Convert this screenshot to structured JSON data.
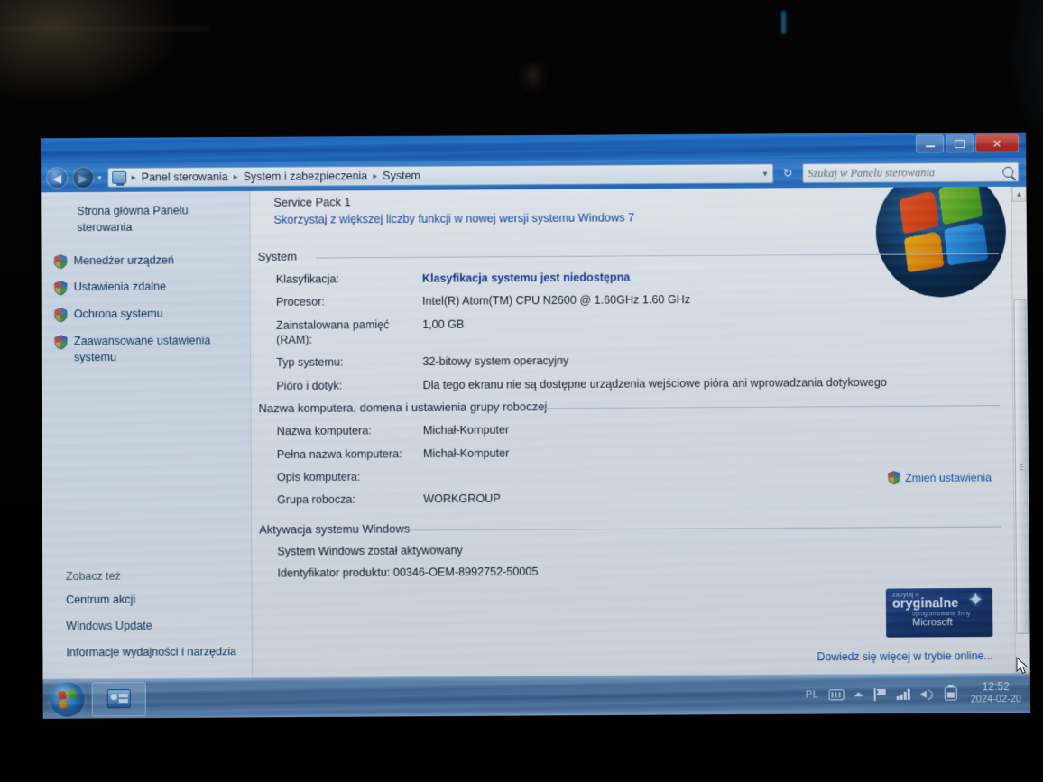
{
  "window": {
    "min_label": "Minimalizuj",
    "max_label": "Maksymalizuj",
    "close_label": "✕"
  },
  "nav": {
    "back_glyph": "◀",
    "forward_glyph": "▶",
    "dropdown_glyph": "▾",
    "refresh_glyph": "↻",
    "breadcrumb": [
      "Panel sterowania",
      "System i zabezpieczenia",
      "System"
    ],
    "separator": "▸",
    "caret": "▾"
  },
  "search": {
    "placeholder": "Szukaj w Panelu sterowania",
    "value": "",
    "icon": "search-icon"
  },
  "sidebar": {
    "home_label": "Strona główna Panelu sterowania",
    "items": [
      {
        "label": "Menedżer urządzeń",
        "icon": "shield-icon"
      },
      {
        "label": "Ustawienia zdalne",
        "icon": "shield-icon"
      },
      {
        "label": "Ochrona systemu",
        "icon": "shield-icon"
      },
      {
        "label": "Zaawansowane ustawienia systemu",
        "icon": "shield-icon"
      }
    ],
    "see_also_title": "Zobacz też",
    "see_also": [
      "Centrum akcji",
      "Windows Update",
      "Informacje wydajności i narzędzia"
    ]
  },
  "content": {
    "service_pack": "Service Pack 1",
    "upgrade_link": "Skorzystaj z większej liczby funkcji w nowej wersji systemu Windows 7",
    "system_section": {
      "heading": "System",
      "rows": [
        {
          "label": "Klasyfikacja:",
          "value": "Klasyfikacja systemu jest niedostępna",
          "style": "blue"
        },
        {
          "label": "Procesor:",
          "value": "Intel(R) Atom(TM) CPU N2600   @ 1.60GHz   1.60 GHz",
          "style": "plain"
        },
        {
          "label": "Zainstalowana pamięć (RAM):",
          "value": "1,00 GB",
          "style": "plain"
        },
        {
          "label": "Typ systemu:",
          "value": "32-bitowy system operacyjny",
          "style": "plain"
        },
        {
          "label": "Pióro i dotyk:",
          "value": "Dla tego ekranu nie są dostępne urządzenia wejściowe pióra ani wprowadzania dotykowego",
          "style": "plain"
        }
      ]
    },
    "computer_section": {
      "heading": "Nazwa komputera, domena i ustawienia grupy roboczej",
      "rows": [
        {
          "label": "Nazwa komputera:",
          "value": "Michał-Komputer",
          "style": "plain"
        },
        {
          "label": "Pełna nazwa komputera:",
          "value": "Michał-Komputer",
          "style": "plain"
        },
        {
          "label": "Opis komputera:",
          "value": "",
          "style": "plain"
        },
        {
          "label": "Grupa robocza:",
          "value": "WORKGROUP",
          "style": "plain"
        }
      ],
      "change_settings_link": "Zmień ustawienia",
      "change_settings_icon": "shield-icon"
    },
    "activation_section": {
      "heading": "Aktywacja systemu Windows",
      "status": "System Windows został aktywowany",
      "product_id": "Identyfikator produktu: 00346-OEM-8992752-50005",
      "badge": {
        "line1": "zapytaj o",
        "line2": "oryginalne",
        "line3": "oprogramowanie firmy",
        "line4": "Microsoft",
        "star": "✦"
      },
      "learn_more": "Dowiedz się więcej w trybie online..."
    },
    "logo": "windows-7-logo"
  },
  "scrollbar": {
    "up_glyph": "▲",
    "down_glyph": "▼"
  },
  "taskbar": {
    "start_label": "Start",
    "buttons": [
      {
        "label": "",
        "icon": "control-panel-icon"
      }
    ],
    "tray": {
      "language": "PL",
      "icons": [
        "keyboard-icon",
        "show-hidden-icons-chevron",
        "action-center-flag-icon",
        "network-signal-icon",
        "volume-speaker-icon",
        "battery-icon"
      ]
    },
    "clock": {
      "time": "12:52",
      "date": "2024-02-20"
    }
  },
  "colors": {
    "titlebar": "#1f68bd",
    "link": "#1b4aa0",
    "close_button": "#c2352c",
    "taskbar": "#3e6896"
  }
}
